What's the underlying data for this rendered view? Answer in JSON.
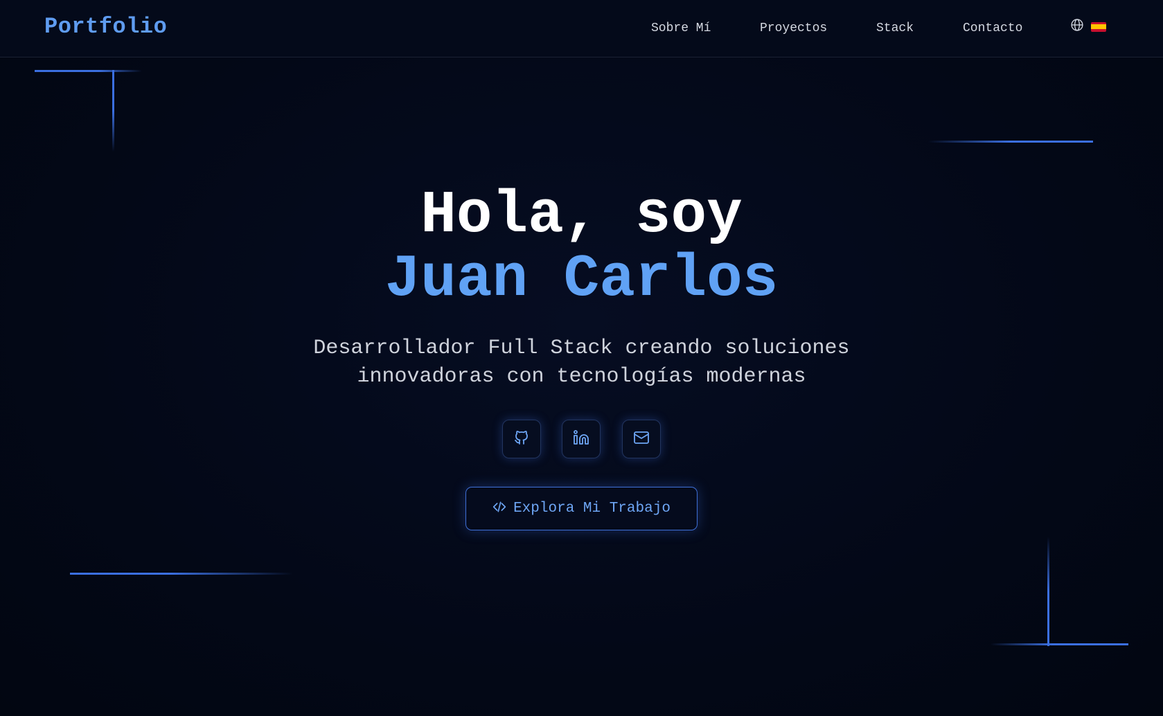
{
  "nav": {
    "brand": "Portfolio",
    "links": [
      {
        "label": "Sobre Mí"
      },
      {
        "label": "Proyectos"
      },
      {
        "label": "Stack"
      },
      {
        "label": "Contacto"
      }
    ],
    "language": {
      "icon": "globe-icon",
      "flag": "spain-flag"
    }
  },
  "hero": {
    "greeting": "Hola, soy",
    "name": "Juan Carlos",
    "subtitle_line1": "Desarrollador Full Stack creando soluciones",
    "subtitle_line2": "innovadoras con tecnologías modernas",
    "socials": [
      {
        "icon": "github-icon"
      },
      {
        "icon": "linkedin-icon"
      },
      {
        "icon": "mail-icon"
      }
    ],
    "cta": {
      "label": "Explora Mi Trabajo",
      "icon": "code-icon"
    }
  },
  "colors": {
    "background": "#030817",
    "accent": "#60a2f5",
    "line": "#3b6fe0"
  }
}
